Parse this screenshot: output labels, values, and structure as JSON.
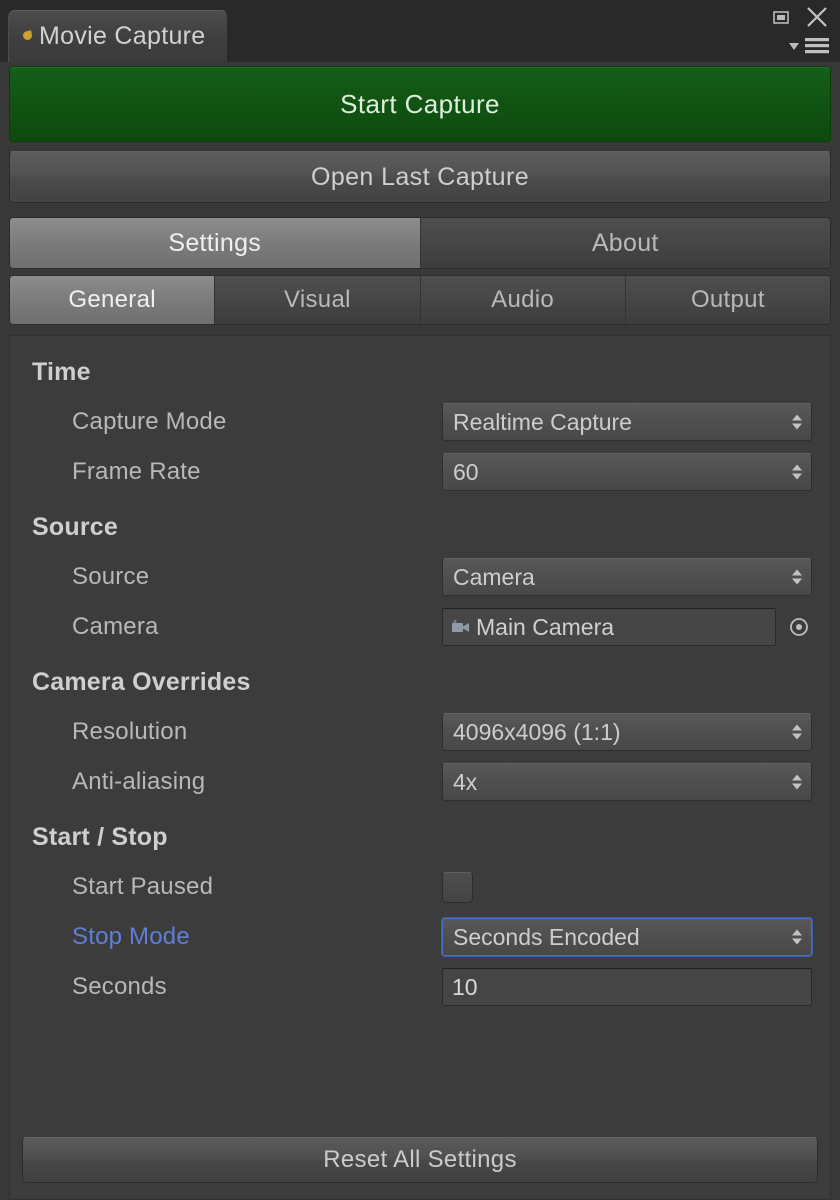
{
  "window": {
    "tab_title": "Movie Capture",
    "tab_icon": "dot-marker-icon",
    "controls": {
      "maximize": "maximize-icon",
      "close": "close-icon",
      "menu": "panel-menu-icon"
    }
  },
  "actions": {
    "start_capture": "Start Capture",
    "open_last_capture": "Open Last Capture",
    "reset_all_settings": "Reset All Settings"
  },
  "main_tabs": [
    {
      "label": "Settings",
      "active": true
    },
    {
      "label": "About",
      "active": false
    }
  ],
  "sub_tabs": [
    {
      "label": "General",
      "active": true
    },
    {
      "label": "Visual",
      "active": false
    },
    {
      "label": "Audio",
      "active": false
    },
    {
      "label": "Output",
      "active": false
    }
  ],
  "sections": {
    "time": {
      "title": "Time",
      "capture_mode": {
        "label": "Capture Mode",
        "value": "Realtime Capture"
      },
      "frame_rate": {
        "label": "Frame Rate",
        "value": "60"
      }
    },
    "source": {
      "title": "Source",
      "source": {
        "label": "Source",
        "value": "Camera"
      },
      "camera": {
        "label": "Camera",
        "value": "Main Camera",
        "icon": "camera-icon",
        "picker": "object-picker-icon"
      }
    },
    "camera_overrides": {
      "title": "Camera Overrides",
      "resolution": {
        "label": "Resolution",
        "value": "4096x4096 (1:1)"
      },
      "anti_aliasing": {
        "label": "Anti-aliasing",
        "value": "4x"
      }
    },
    "start_stop": {
      "title": "Start / Stop",
      "start_paused": {
        "label": "Start Paused",
        "checked": false
      },
      "stop_mode": {
        "label": "Stop Mode",
        "value": "Seconds Encoded",
        "highlighted": true,
        "focused": true
      },
      "seconds": {
        "label": "Seconds",
        "value": "10"
      }
    }
  },
  "colors": {
    "window_bg": "#383838",
    "titlebar_bg": "#292929",
    "panel_bg": "#3c3c3c",
    "capture_green": "#125614",
    "accent_blue": "#5f7fd6",
    "text": "#b8b8b8"
  }
}
